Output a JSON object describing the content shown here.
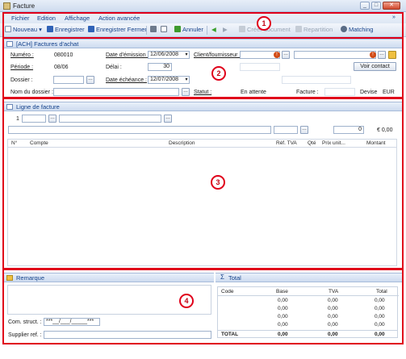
{
  "window": {
    "title": "Facture"
  },
  "menu": {
    "items": [
      "Fichier",
      "Edition",
      "Affichage",
      "Action avancée"
    ]
  },
  "toolbar": {
    "nouveau": "Nouveau",
    "enregistrer": "Enregistrer",
    "enregistrer_fermer": "Enregistrer Fermer",
    "annuler": "Annuler",
    "creer_document": "Créer document",
    "repartition": "Repartition",
    "matching": "Matching"
  },
  "header_section": {
    "title": "[ACH] Factures d'achat",
    "numero_label": "Numéro :",
    "numero_value": "080010",
    "periode_label": "Période :",
    "periode_value": "08/06",
    "dossier_label": "Dossier :",
    "nom_dossier_label": "Nom du dossier :",
    "date_emission_label": "Date d'émission :",
    "date_emission_value": "12/06/2008",
    "delai_label": "Délai :",
    "delai_value": "30",
    "date_echeance_label": "Date échéance :",
    "date_echeance_value": "12/07/2008",
    "client_label": "Client/fournisseur :",
    "voir_contact": "Voir contact",
    "statut_label": "Statut :",
    "statut_value": "En attente",
    "facture_label": "Facture :",
    "devise_label": "Devise",
    "devise_value": "EUR"
  },
  "ligne_section": {
    "title": "Ligne de facture",
    "line_number": "1",
    "qty_value": "0",
    "amount_value": "€ 0,00",
    "columns": [
      "N°",
      "Compte",
      "Description",
      "Réf. TVA",
      "Qté",
      "Prix unit...",
      "Montant"
    ]
  },
  "remarque_section": {
    "title": "Remarque",
    "com_struct_label": "Com. struct. :",
    "com_struct_value": "***__/___/_____***",
    "supplier_ref_label": "Supplier ref. :"
  },
  "total_section": {
    "title": "Total",
    "columns": [
      "Code",
      "Base",
      "TVA",
      "Total"
    ],
    "rows": [
      [
        "",
        "0,00",
        "0,00",
        "0,00"
      ],
      [
        "",
        "0,00",
        "0,00",
        "0,00"
      ],
      [
        "",
        "0,00",
        "0,00",
        "0,00"
      ],
      [
        "",
        "0,00",
        "0,00",
        "0,00"
      ]
    ],
    "total_label": "TOTAL",
    "total_values": [
      "0,00",
      "0,00",
      "0,00"
    ]
  },
  "callouts": [
    "1",
    "2",
    "3",
    "4"
  ]
}
